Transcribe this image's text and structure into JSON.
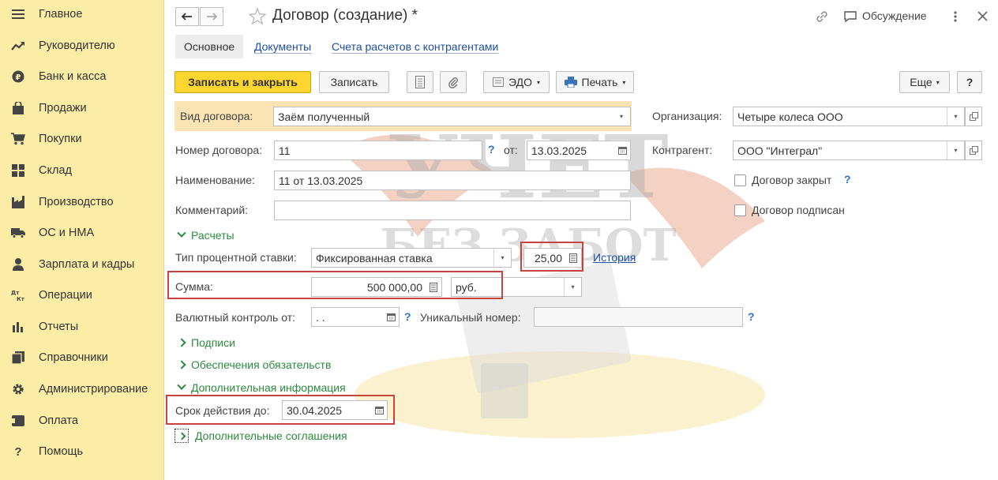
{
  "sidebar": {
    "items": [
      {
        "label": "Главное",
        "icon": "menu-icon"
      },
      {
        "label": "Руководителю",
        "icon": "trend-icon"
      },
      {
        "label": "Банк и касса",
        "icon": "coin-icon"
      },
      {
        "label": "Продажи",
        "icon": "bag-icon"
      },
      {
        "label": "Покупки",
        "icon": "cart-icon"
      },
      {
        "label": "Склад",
        "icon": "warehouse-icon"
      },
      {
        "label": "Производство",
        "icon": "factory-icon"
      },
      {
        "label": "ОС и НМА",
        "icon": "truck-icon"
      },
      {
        "label": "Зарплата и кадры",
        "icon": "person-icon"
      },
      {
        "label": "Операции",
        "icon": "dt-kt-icon"
      },
      {
        "label": "Отчеты",
        "icon": "bar-chart-icon"
      },
      {
        "label": "Справочники",
        "icon": "books-icon"
      },
      {
        "label": "Администрирование",
        "icon": "gear-icon"
      },
      {
        "label": "Оплата",
        "icon": "card-icon"
      },
      {
        "label": "Помощь",
        "icon": "question-icon"
      }
    ]
  },
  "header": {
    "title": "Договор (создание) *",
    "discussion": "Обсуждение"
  },
  "tabs": [
    "Основное",
    "Документы",
    "Счета расчетов с контрагентами"
  ],
  "toolbar": {
    "save_close": "Записать и закрыть",
    "save": "Записать",
    "edo": "ЭДО",
    "print": "Печать",
    "more": "Еще",
    "help": "?"
  },
  "form": {
    "contract_type_label": "Вид договора:",
    "contract_type_value": "Заём полученный",
    "organization_label": "Организация:",
    "organization_value": "Четыре колеса ООО",
    "number_label": "Номер договора:",
    "number_value": "11",
    "from_label": "от:",
    "date_value": "13.03.2025",
    "counterparty_label": "Контрагент:",
    "counterparty_value": "ООО \"Интеграл\"",
    "name_label": "Наименование:",
    "name_value": "11 от 13.03.2025",
    "closed_label": "Договор закрыт",
    "comment_label": "Комментарий:",
    "comment_value": "",
    "signed_label": "Договор подписан",
    "settlements_group": "Расчеты",
    "rate_type_label": "Тип процентной ставки:",
    "rate_type_value": "Фиксированная ставка",
    "rate_value": "25,00",
    "history_link": "История",
    "sum_label": "Сумма:",
    "sum_value": "500 000,00",
    "currency_value": "руб.",
    "currency_control_label": "Валютный контроль от:",
    "currency_control_value": " .  .",
    "unique_number_label": "Уникальный номер:",
    "unique_number_value": "",
    "signatures_group": "Подписи",
    "security_group": "Обеспечения обязательств",
    "additional_group": "Дополнительная информация",
    "valid_until_label": "Срок действия до:",
    "valid_until_value": "30.04.2025",
    "supplements_group": "Дополнительные соглашения"
  },
  "watermark": {
    "line1": "УЧЕТ",
    "line2": "БЕЗ ЗАБОТ"
  },
  "colors": {
    "sidebar_bg": "#fbeda6",
    "primary_button": "#fdd531",
    "link": "#1f4fa0",
    "group": "#2b8a3e",
    "highlight_box": "#c8423f"
  }
}
